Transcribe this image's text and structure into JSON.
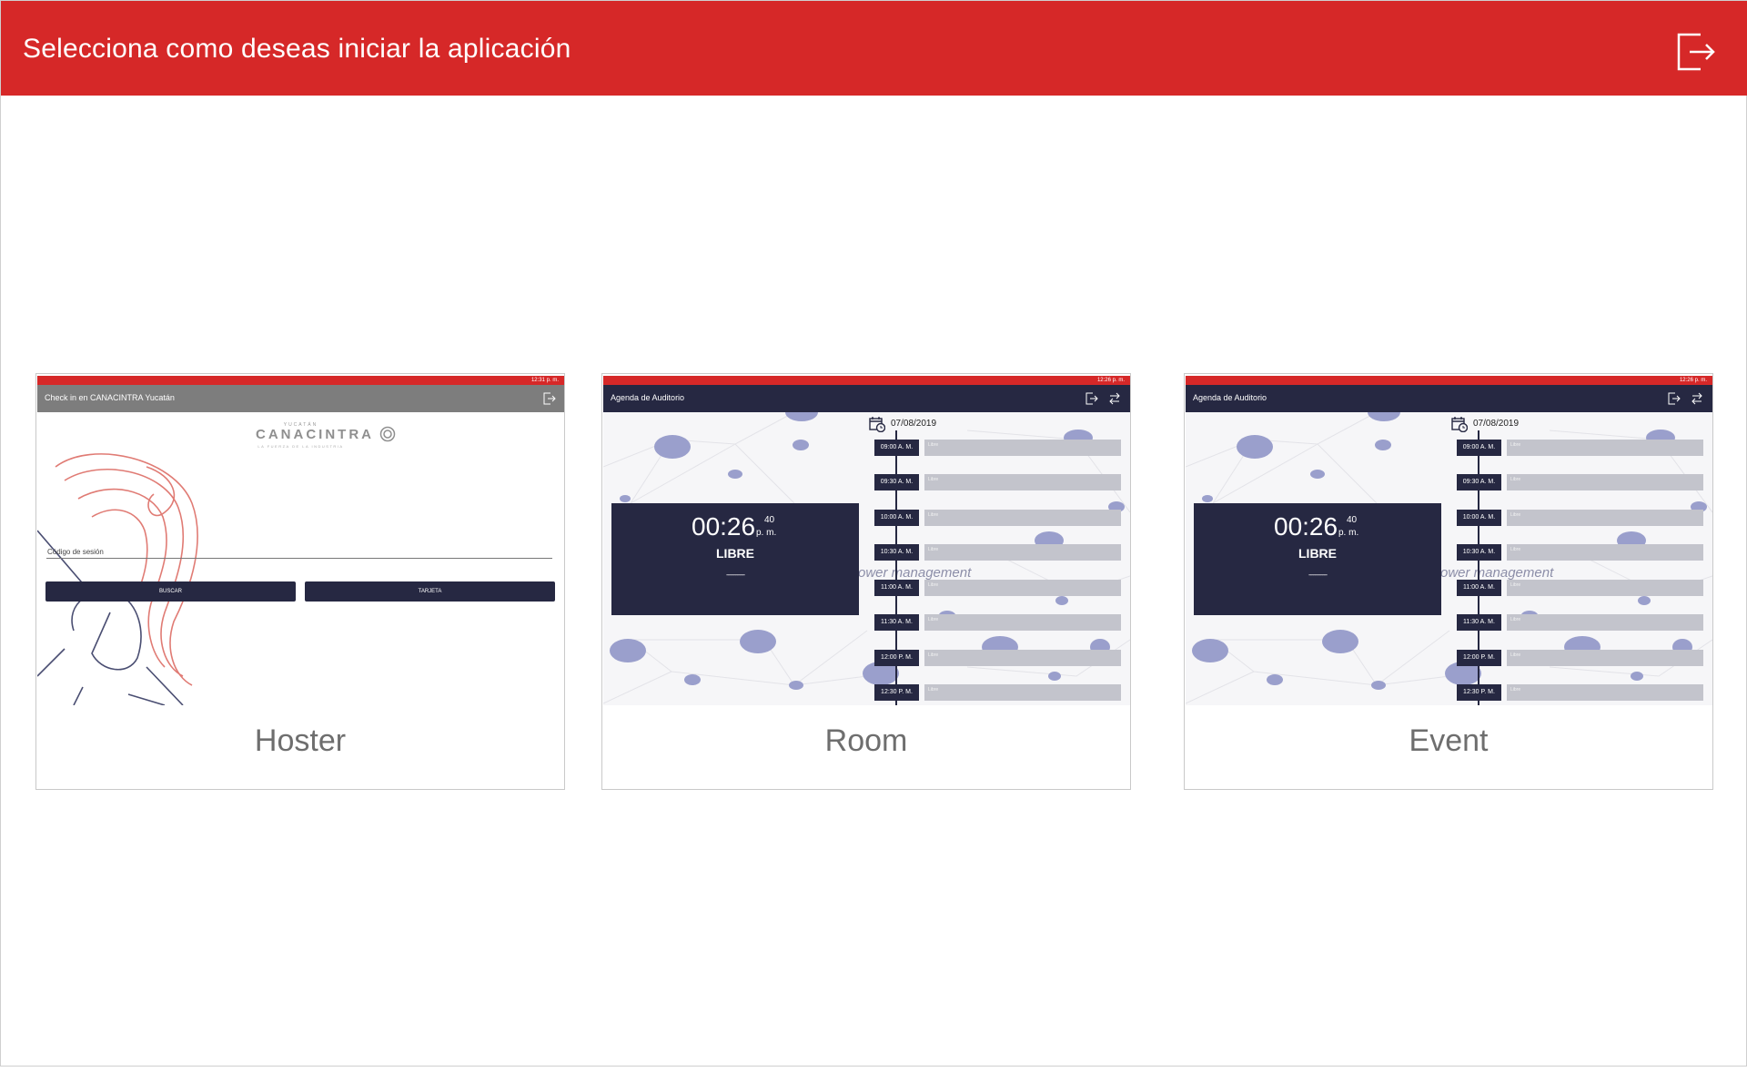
{
  "header": {
    "title": "Selecciona como deseas iniciar la aplicación",
    "exit_icon": "exit-icon",
    "background": "#d62828"
  },
  "cards": [
    {
      "label": "Hoster",
      "preview": {
        "status_time": "12:31 p. m.",
        "bar_title": "Check in en CANACINTRA Yucatán",
        "logo_top": "YUCATÁN",
        "logo_main": "CANACINTRA",
        "logo_sub": "LA FUERZA DE LA INDUSTRIA",
        "field_label": "Código de sesión",
        "button_search": "BUSCAR",
        "button_card": "TARJETA"
      }
    },
    {
      "label": "Room",
      "preview": {
        "status_time": "12:26 p. m.",
        "bar_title": "Agenda de Auditorio",
        "date": "07/08/2019",
        "clock_time": "00:26",
        "clock_seconds": "40",
        "clock_ampm": "p. m.",
        "status": "LIBRE",
        "dashes": "------------",
        "watermark": "ower management",
        "slots": [
          {
            "time": "09:00 A. M.",
            "label": "Libre"
          },
          {
            "time": "09:30 A. M.",
            "label": "Libre"
          },
          {
            "time": "10:00 A. M.",
            "label": "Libre"
          },
          {
            "time": "10:30 A. M.",
            "label": "Libre"
          },
          {
            "time": "11:00 A. M.",
            "label": "Libre"
          },
          {
            "time": "11:30 A. M.",
            "label": "Libre"
          },
          {
            "time": "12:00 P. M.",
            "label": "Libre"
          },
          {
            "time": "12:30 P. M.",
            "label": "Libre"
          }
        ]
      }
    },
    {
      "label": "Event",
      "preview": {
        "status_time": "12:26 p. m.",
        "bar_title": "Agenda de Auditorio",
        "date": "07/08/2019",
        "clock_time": "00:26",
        "clock_seconds": "40",
        "clock_ampm": "p. m.",
        "status": "LIBRE",
        "dashes": "------------",
        "watermark": "ower management",
        "slots": [
          {
            "time": "09:00 A. M.",
            "label": "Libre"
          },
          {
            "time": "09:30 A. M.",
            "label": "Libre"
          },
          {
            "time": "10:00 A. M.",
            "label": "Libre"
          },
          {
            "time": "10:30 A. M.",
            "label": "Libre"
          },
          {
            "time": "11:00 A. M.",
            "label": "Libre"
          },
          {
            "time": "11:30 A. M.",
            "label": "Libre"
          },
          {
            "time": "12:00 P. M.",
            "label": "Libre"
          },
          {
            "time": "12:30 P. M.",
            "label": "Libre"
          }
        ]
      }
    }
  ]
}
